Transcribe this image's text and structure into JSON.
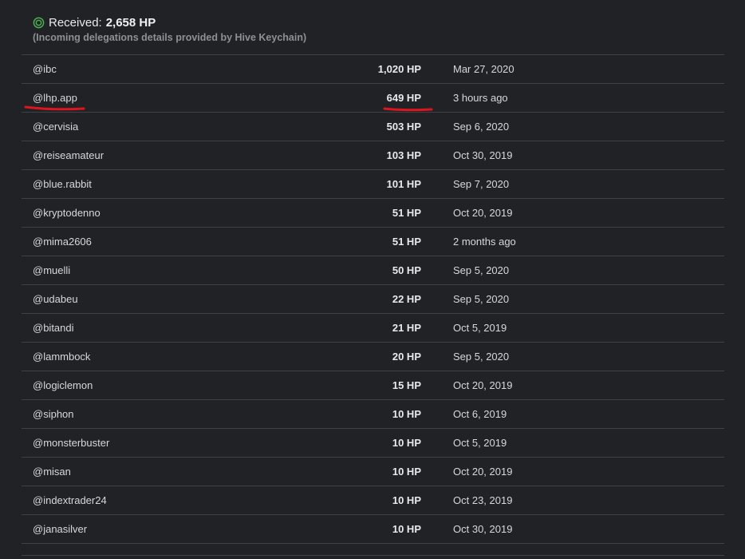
{
  "header": {
    "received_label": "Received:",
    "received_value": "2,658 HP",
    "subtitle": "(Incoming delegations details provided by Hive Keychain)",
    "icon": "ring-icon"
  },
  "colors": {
    "background": "#202226",
    "accent_green": "#4caf50",
    "underline_red": "#e0141e"
  },
  "delegations": [
    {
      "name": "@ibc",
      "amount": "1,020 HP",
      "date": "Mar 27, 2020"
    },
    {
      "name": "@lhp.app",
      "amount": "649 HP",
      "date": "3 hours ago"
    },
    {
      "name": "@cervisia",
      "amount": "503 HP",
      "date": "Sep 6, 2020"
    },
    {
      "name": "@reiseamateur",
      "amount": "103 HP",
      "date": "Oct 30, 2019"
    },
    {
      "name": "@blue.rabbit",
      "amount": "101 HP",
      "date": "Sep 7, 2020"
    },
    {
      "name": "@kryptodenno",
      "amount": "51 HP",
      "date": "Oct 20, 2019"
    },
    {
      "name": "@mima2606",
      "amount": "51 HP",
      "date": "2 months ago"
    },
    {
      "name": "@muelli",
      "amount": "50 HP",
      "date": "Sep 5, 2020"
    },
    {
      "name": "@udabeu",
      "amount": "22 HP",
      "date": "Sep 5, 2020"
    },
    {
      "name": "@bitandi",
      "amount": "21 HP",
      "date": "Oct 5, 2019"
    },
    {
      "name": "@lammbock",
      "amount": "20 HP",
      "date": "Sep 5, 2020"
    },
    {
      "name": "@logiclemon",
      "amount": "15 HP",
      "date": "Oct 20, 2019"
    },
    {
      "name": "@siphon",
      "amount": "10 HP",
      "date": "Oct 6, 2019"
    },
    {
      "name": "@monsterbuster",
      "amount": "10 HP",
      "date": "Oct 5, 2019"
    },
    {
      "name": "@misan",
      "amount": "10 HP",
      "date": "Oct 20, 2019"
    },
    {
      "name": "@indextrader24",
      "amount": "10 HP",
      "date": "Oct 23, 2019"
    },
    {
      "name": "@janasilver",
      "amount": "10 HP",
      "date": "Oct 30, 2019"
    }
  ]
}
